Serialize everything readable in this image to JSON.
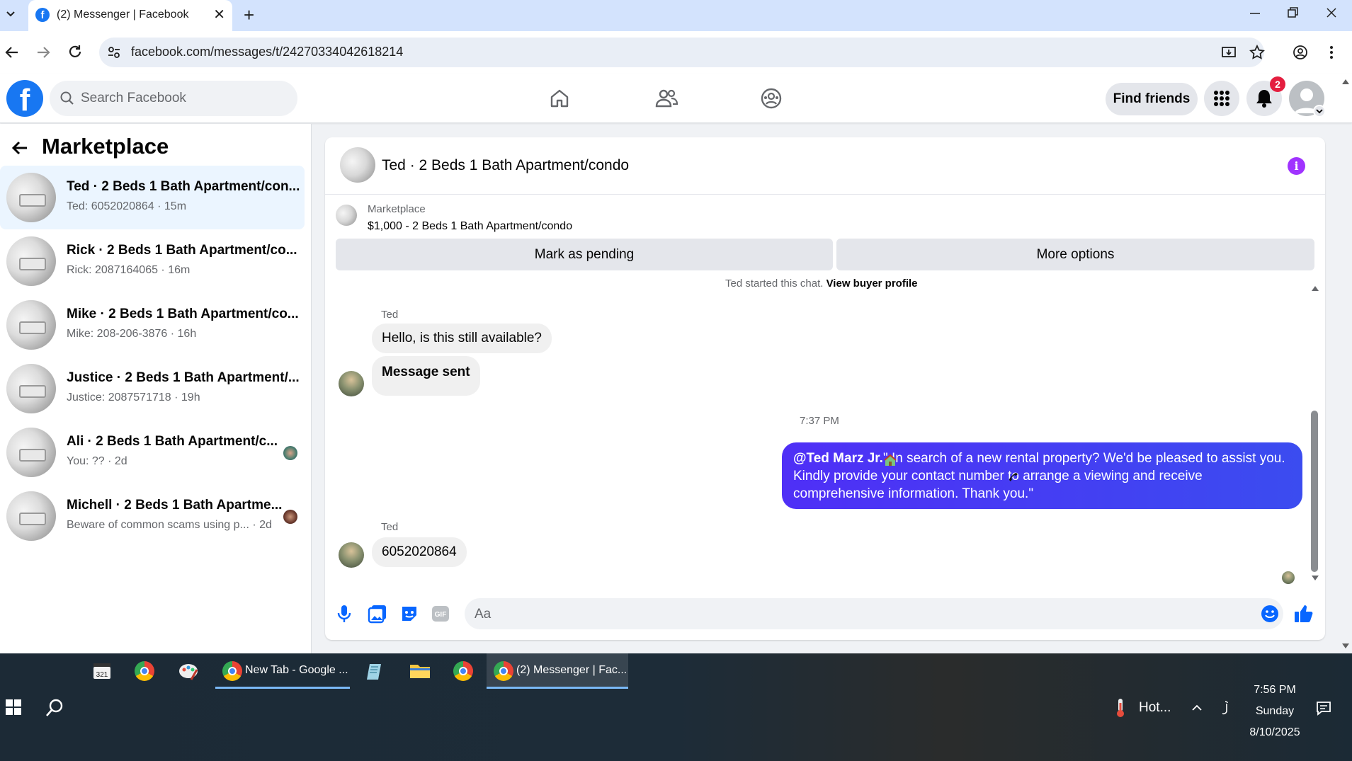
{
  "browser": {
    "tab_title": "(2) Messenger | Facebook",
    "url": "facebook.com/messages/t/24270334042618214"
  },
  "header": {
    "search_placeholder": "Search Facebook",
    "find_friends": "Find friends",
    "notification_count": "2"
  },
  "sidebar": {
    "title": "Marketplace",
    "conversations": [
      {
        "name": "Ted · 2 Beds 1 Bath Apartment/con...",
        "sub": "Ted: 6052020864 · 15m"
      },
      {
        "name": "Rick · 2 Beds 1 Bath Apartment/co...",
        "sub": "Rick: 2087164065 · 16m"
      },
      {
        "name": "Mike · 2 Beds 1 Bath Apartment/co...",
        "sub": "Mike: 208-206-3876 · 16h"
      },
      {
        "name": "Justice · 2 Beds 1 Bath Apartment/...",
        "sub": "Justice: 2087571718 · 19h"
      },
      {
        "name": "Ali · 2 Beds 1 Bath Apartment/c...",
        "sub": "You: ?? · 2d"
      },
      {
        "name": "Michell · 2 Beds 1 Bath Apartme...",
        "sub": "Beware of common scams using p... · 2d"
      }
    ]
  },
  "chat": {
    "title": "Ted · 2 Beds 1 Bath Apartment/condo",
    "marketplace_label": "Marketplace",
    "listing": "$1,000 - 2 Beds 1 Bath Apartment/condo",
    "mark_pending": "Mark as pending",
    "more_options": "More options",
    "started_text": "Ted started this chat.",
    "view_buyer_profile": "View buyer profile",
    "sender1": "Ted",
    "msg1": "Hello, is this still available?",
    "msg2": "Message sent",
    "time_separator": "7:37 PM",
    "out_mention": "@Ted Marz Jr.",
    "out_line1": "\" In search of a new rental property? We'd be pleased to assist you.",
    "out_line2": "Kindly provide your contact number   to arrange a viewing and receive",
    "out_line3": "comprehensive information. Thank you.\"",
    "sender2": "Ted",
    "msg3": "6052020864",
    "composer_placeholder": "Aa"
  },
  "taskbar": {
    "chrome_newtab": "New Tab - Google ...",
    "chrome_messenger": "(2) Messenger | Fac...",
    "weather": "Hot...",
    "time": "7:56 PM",
    "day": "Sunday",
    "date": "8/10/2025"
  },
  "colors": {
    "fb_blue": "#1877f2",
    "outgoing_bubble": "#4a35f5",
    "active_conv": "#ebf5ff",
    "notification_red": "#e41e3f"
  }
}
